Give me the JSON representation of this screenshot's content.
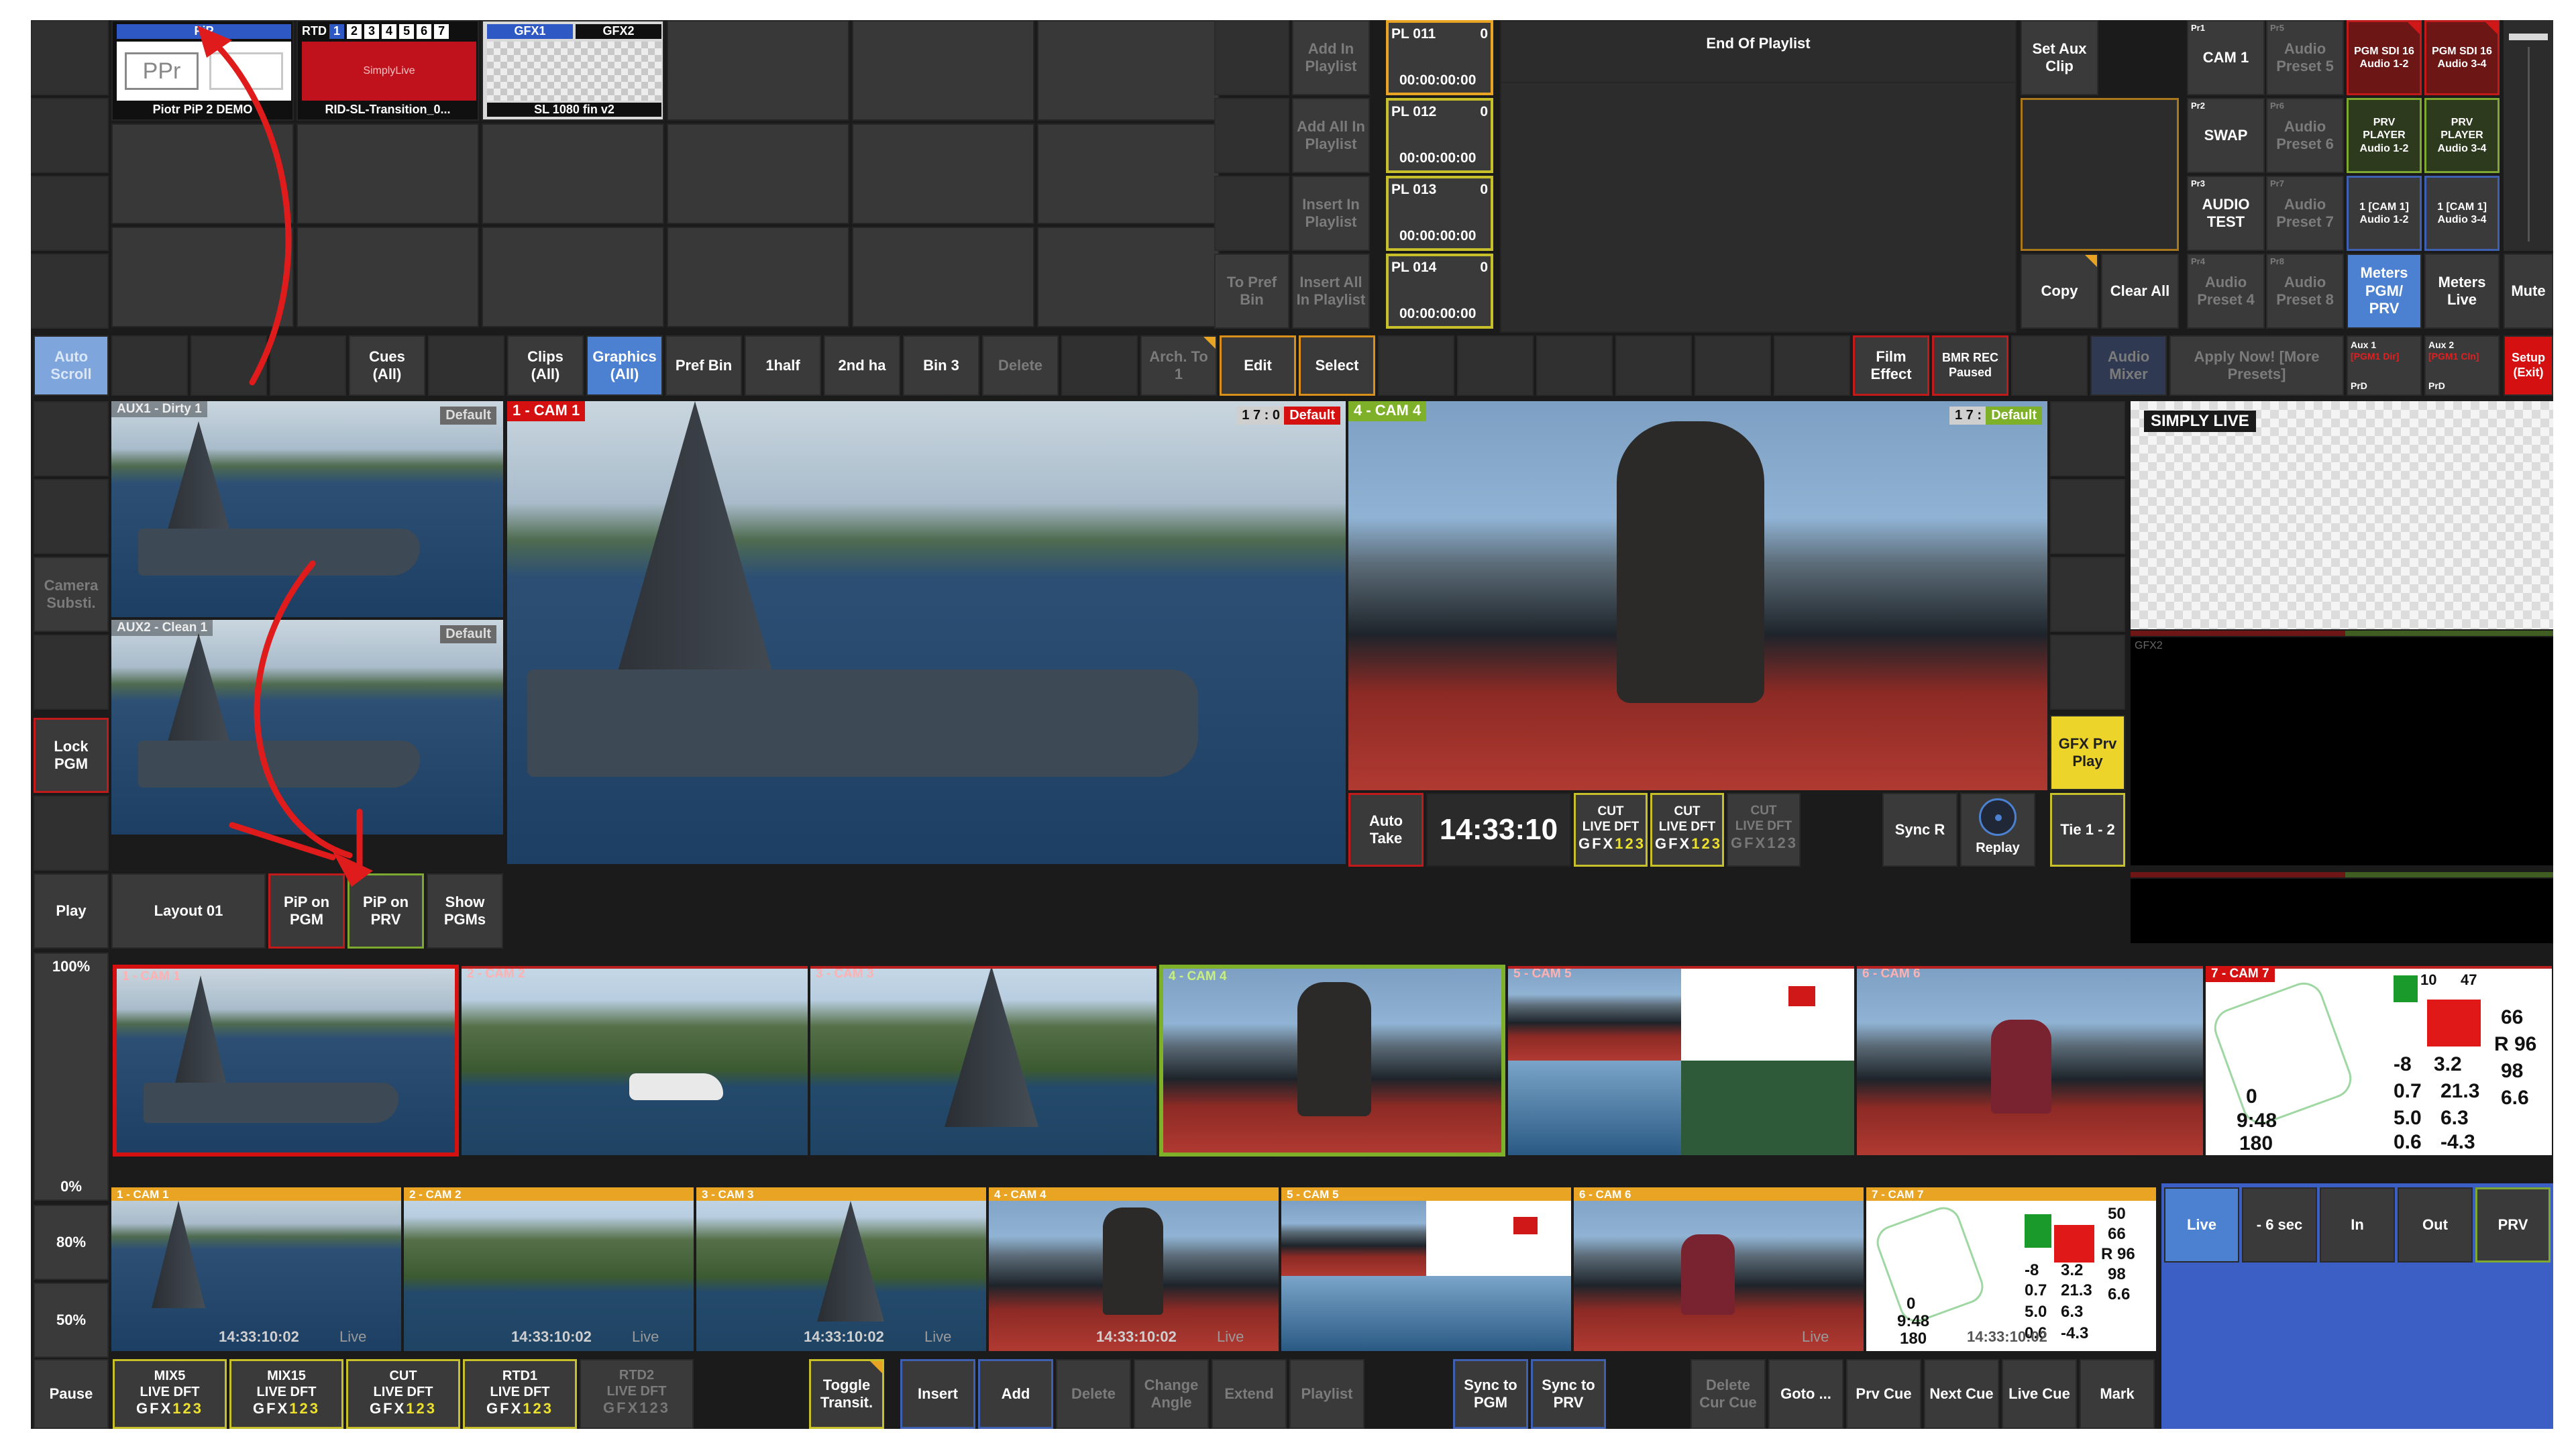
{
  "top_bins": {
    "tiles": [
      {
        "header": "PiP",
        "name": "Piotr PiP 2 DEMO",
        "thumb": "PPr"
      },
      {
        "header": "RTD",
        "name": "RID-SL-Transition_0...",
        "thumb": "SimplyLive",
        "numbers": [
          "1",
          "2",
          "3",
          "4",
          "5",
          "6",
          "7"
        ]
      },
      {
        "header_left": "GFX1",
        "header_right": "GFX2",
        "name": "SL 1080 fin v2"
      }
    ]
  },
  "playlist_actions": {
    "add_in_playlist": "Add In Playlist",
    "add_all_in_playlist": "Add All In Playlist",
    "insert_in_playlist": "Insert In Playlist",
    "insert_all_in_playlist": "Insert All In Playlist",
    "to_pref_bin": "To Pref Bin"
  },
  "playlists": [
    {
      "name": "PL 011",
      "count": "0",
      "time": "00:00:00:00"
    },
    {
      "name": "PL 012",
      "count": "0",
      "time": "00:00:00:00"
    },
    {
      "name": "PL 013",
      "count": "0",
      "time": "00:00:00:00"
    },
    {
      "name": "PL 014",
      "count": "0",
      "time": "00:00:00:00"
    }
  ],
  "end_of_playlist": "End Of Playlist",
  "aux_clip": {
    "set_aux_clip": "Set Aux Clip",
    "copy": "Copy",
    "clear_all": "Clear All"
  },
  "audio_presets": {
    "cam1": {
      "prefix": "Pr1",
      "label": "CAM 1"
    },
    "swap": {
      "prefix": "Pr2",
      "label": "SWAP"
    },
    "audio_test": {
      "prefix": "Pr3",
      "label": "AUDIO TEST"
    },
    "preset4": {
      "prefix": "Pr4",
      "label": "Audio Preset 4"
    },
    "preset5": {
      "prefix": "Pr5",
      "label": "Audio Preset 5"
    },
    "preset6": {
      "prefix": "Pr6",
      "label": "Audio Preset 6"
    },
    "preset7": {
      "prefix": "Pr7",
      "label": "Audio Preset 7"
    },
    "preset8": {
      "prefix": "Pr8",
      "label": "Audio Preset 8"
    }
  },
  "audio_routing": [
    {
      "label": "PGM SDI 16 Audio 1-2"
    },
    {
      "label": "PGM SDI 16 Audio 3-4"
    },
    {
      "label": "PRV PLAYER Audio 1-2"
    },
    {
      "label": "PRV PLAYER Audio 3-4"
    },
    {
      "label": "1 [CAM 1] Audio 1-2"
    },
    {
      "label": "1 [CAM 1] Audio 3-4"
    }
  ],
  "meters": {
    "pgm_prv": "Meters PGM/ PRV",
    "live": "Meters Live",
    "mute": "Mute"
  },
  "toolbar": {
    "auto_scroll": "Auto Scroll",
    "cues_all": "Cues (All)",
    "clips_all": "Clips (All)",
    "graphics_all": "Graphics (All)",
    "pref_bin": "Pref Bin",
    "half1": "1half",
    "half2": "2nd ha",
    "bin3": "Bin 3",
    "delete": "Delete",
    "arch_to": "Arch. To 1",
    "edit": "Edit",
    "select": "Select",
    "film_effect": "Film Effect",
    "bmr_rec": "BMR REC Paused",
    "audio_mixer": "Audio Mixer",
    "apply_now": "Apply Now! [More Presets]",
    "aux1": {
      "top": "Aux 1",
      "mid": "[PGM1 Dir]",
      "bottom": "PrD"
    },
    "aux2": {
      "top": "Aux 2",
      "mid": "[PGM1 Cln]",
      "bottom": "PrD"
    },
    "setup": "Setup (Exit)"
  },
  "left_buttons": {
    "camera_subst": "Camera Substi.",
    "lock_pgm": "Lock PGM",
    "play": "Play",
    "pause": "Pause"
  },
  "aux_views": [
    {
      "label": "AUX1 - Dirty 1",
      "badge": "Default"
    },
    {
      "label": "AUX2 - Clean 1",
      "badge": "Default"
    }
  ],
  "pgm_view": {
    "label": "1 - CAM 1",
    "counter": "1 7 : 0",
    "badge": "Default"
  },
  "prv_view": {
    "label": "4 - CAM 4",
    "counter": "1 7 :",
    "badge": "Default"
  },
  "monitor": {
    "logo": "SIMPLY LIVE",
    "gfx2": "GFX2"
  },
  "transport": {
    "auto_take": "Auto Take",
    "clock": "14:33:10",
    "cut_buttons": [
      {
        "line1": "CUT",
        "line2": "LIVE DFT",
        "gfx_a": "GFX",
        "gfx_b": "123"
      },
      {
        "line1": "CUT",
        "line2": "LIVE DFT",
        "gfx_a": "GFX",
        "gfx_b": "123"
      },
      {
        "line1": "CUT",
        "line2": "LIVE DFT",
        "gfx_a": "GFX",
        "gfx_b": "123"
      }
    ],
    "sync_r": "Sync R",
    "replay": "Replay",
    "tie": "Tie 1 - 2",
    "gfx_prv_play": "GFX Prv Play"
  },
  "layout_row": {
    "layout": "Layout 01",
    "pip_pgm": "PiP on PGM",
    "pip_prv": "PiP on PRV",
    "show_pgms": "Show PGMs"
  },
  "zoom": {
    "z100": "100%",
    "z0": "0%",
    "z80": "80%",
    "z50": "50%"
  },
  "live_cams": [
    {
      "label": "1 - CAM 1"
    },
    {
      "label": "2 - CAM 2"
    },
    {
      "label": "3 - CAM 3"
    },
    {
      "label": "4 - CAM 4"
    },
    {
      "label": "5 - CAM 5"
    },
    {
      "label": "6 - CAM 6"
    },
    {
      "label": "7 - CAM 7"
    }
  ],
  "replay_cams": [
    {
      "label": "1 - CAM 1",
      "time": "14:33:10:02",
      "live": "Live"
    },
    {
      "label": "2 - CAM 2",
      "time": "14:33:10:02",
      "live": "Live"
    },
    {
      "label": "3 - CAM 3",
      "time": "14:33:10:02",
      "live": "Live"
    },
    {
      "label": "4 - CAM 4",
      "time": "14:33:10:02",
      "live": "Live"
    },
    {
      "label": "5 - CAM 5",
      "time": "",
      "live": ""
    },
    {
      "label": "6 - CAM 6",
      "time": "",
      "live": "Live"
    },
    {
      "label": "7 - CAM 7",
      "time": "14:33:10:02",
      "live": ""
    }
  ],
  "telemetry": {
    "cam7_big": [
      "10",
      "47",
      "66",
      "R 96",
      "98",
      "-8",
      "3.2",
      "0.7",
      "21.3",
      "6.6",
      "5.0",
      "6.3",
      "0.6",
      "-4.3",
      "0",
      "9:48",
      "180"
    ],
    "cam7_small": [
      "50",
      "66",
      "R 96",
      "98",
      "-8",
      "3.2",
      "0.7",
      "21.3",
      "6.6",
      "5.0",
      "6.3",
      "0.6",
      "-4.3",
      "0",
      "9:48",
      "180"
    ]
  },
  "replay_controls": {
    "live": "Live",
    "minus6": "- 6 sec",
    "in": "In",
    "out": "Out",
    "prv": "PRV"
  },
  "bottom_bar": {
    "mixes": [
      {
        "line1": "MIX5",
        "line2": "LIVE DFT"
      },
      {
        "line1": "MIX15",
        "line2": "LIVE DFT"
      },
      {
        "line1": "CUT",
        "line2": "LIVE DFT"
      },
      {
        "line1": "RTD1",
        "line2": "LIVE DFT"
      },
      {
        "line1": "RTD2",
        "line2": "LIVE DFT"
      }
    ],
    "gfx_a": "GFX",
    "gfx_b": "123",
    "toggle_transit": "Toggle Transit.",
    "insert": "Insert",
    "add": "Add",
    "delete": "Delete",
    "change_angle": "Change Angle",
    "extend": "Extend",
    "playlist": "Playlist",
    "sync_pgm": "Sync to PGM",
    "sync_prv": "Sync to PRV",
    "delete_cur_cue": "Delete Cur Cue",
    "goto": "Goto ...",
    "prv_cue": "Prv Cue",
    "next_cue": "Next Cue",
    "live_cue": "Live Cue",
    "mark": "Mark"
  },
  "colors": {
    "accent_blue": "#4c80d0",
    "pgm_red": "#d41010",
    "prv_green": "#7fb02a",
    "orange": "#e8a422",
    "gfx_yellow": "#ece030"
  }
}
